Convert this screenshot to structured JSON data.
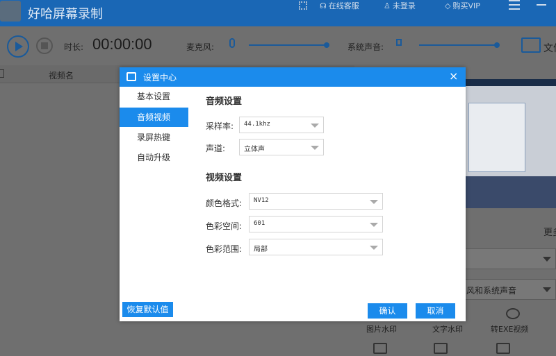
{
  "app": {
    "title": "好哈屏幕录制",
    "online_support": "在线客服",
    "login": "未登录",
    "buy_vip": "购买VIP"
  },
  "toolbar": {
    "duration_label": "时长:",
    "duration_value": "00:00:00",
    "mic_label": "麦克风:",
    "system_audio_label": "系统声音:",
    "folder_label": "文件"
  },
  "list": {
    "column_name": "视频名"
  },
  "right": {
    "more_label": "更多",
    "audio_source_value": "风和系统声音",
    "functions": [
      "图片水印",
      "文字水印",
      "转EXE视频"
    ]
  },
  "dialog": {
    "title": "设置中心",
    "close": "×",
    "nav": [
      {
        "label": "基本设置",
        "active": false
      },
      {
        "label": "音频视频",
        "active": true
      },
      {
        "label": "录屏热键",
        "active": false
      },
      {
        "label": "自动升级",
        "active": false
      }
    ],
    "audio_section": "音频设置",
    "sample_rate_label": "采样率:",
    "sample_rate_value": "44.1khz",
    "channel_label": "声道:",
    "channel_value": "立体声",
    "video_section": "视频设置",
    "color_format_label": "颜色格式:",
    "color_format_value": "NV12",
    "color_space_label": "色彩空间:",
    "color_space_value": "601",
    "color_range_label": "色彩范围:",
    "color_range_value": "局部",
    "restore_defaults": "恢复默认值",
    "confirm": "确认",
    "cancel": "取消"
  },
  "colors": {
    "titlebar": "#1a67b5",
    "accent": "#1b8bec"
  }
}
